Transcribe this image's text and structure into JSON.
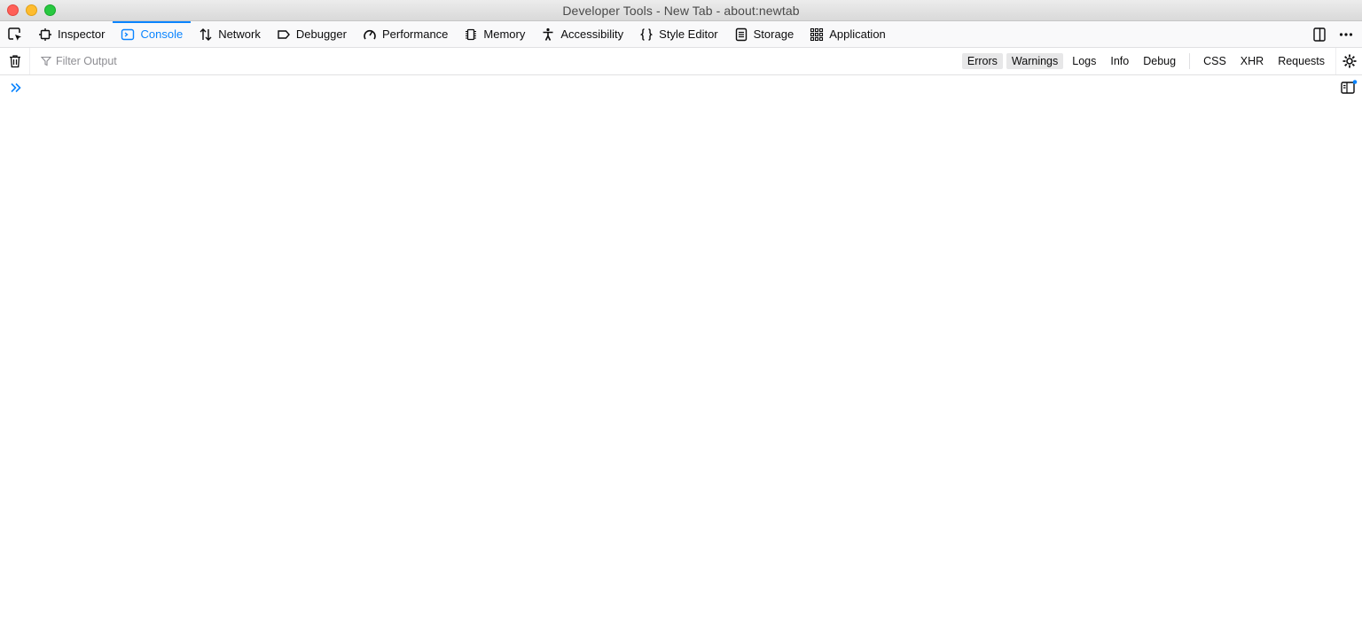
{
  "window": {
    "title": "Developer Tools - New Tab - about:newtab"
  },
  "tabs": [
    {
      "label": "Inspector",
      "icon": "inspector-icon"
    },
    {
      "label": "Console",
      "icon": "console-icon",
      "selected": true
    },
    {
      "label": "Network",
      "icon": "network-icon"
    },
    {
      "label": "Debugger",
      "icon": "debugger-icon"
    },
    {
      "label": "Performance",
      "icon": "performance-icon"
    },
    {
      "label": "Memory",
      "icon": "memory-icon"
    },
    {
      "label": "Accessibility",
      "icon": "accessibility-icon"
    },
    {
      "label": "Style Editor",
      "icon": "style-editor-icon"
    },
    {
      "label": "Storage",
      "icon": "storage-icon"
    },
    {
      "label": "Application",
      "icon": "application-icon"
    }
  ],
  "toolbar": {
    "filter_placeholder": "Filter Output",
    "levels": {
      "errors": "Errors",
      "warnings": "Warnings",
      "logs": "Logs",
      "info": "Info",
      "debug": "Debug"
    },
    "extras": {
      "css": "CSS",
      "xhr": "XHR",
      "requests": "Requests"
    },
    "active_levels": [
      "Errors",
      "Warnings"
    ]
  },
  "colors": {
    "accent": "#0a84ff",
    "text": "#0c0c0d",
    "toolbar_bg": "#f9f9fa"
  }
}
